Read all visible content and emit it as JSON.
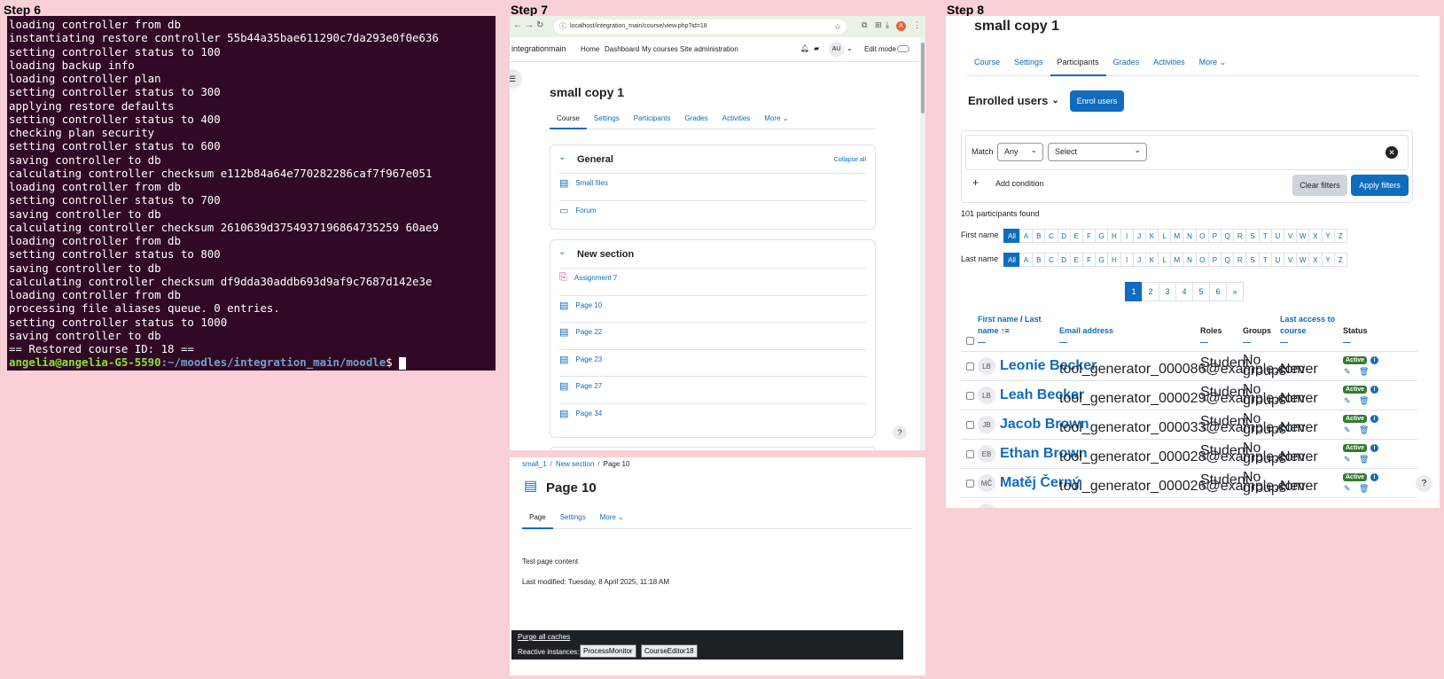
{
  "steps": {
    "s6": "Step 6",
    "s7": "Step 7",
    "s8": "Step 8"
  },
  "terminal": {
    "lines": [
      "loading controller from db",
      "instantiating restore controller 55b44a35bae611290c7da293e0f0e636",
      "setting controller status to 100",
      "loading backup info",
      "loading controller plan",
      "setting controller status to 300",
      "applying restore defaults",
      "setting controller status to 400",
      "checking plan security",
      "setting controller status to 600",
      "saving controller to db",
      "calculating controller checksum e112b84a64e770282286caf7f967e051",
      "loading controller from db",
      "setting controller status to 700",
      "saving controller to db",
      "calculating controller checksum 2610639d3754937196864735259 60ae9",
      "loading controller from db",
      "setting controller status to 800",
      "saving controller to db",
      "calculating controller checksum df9dda30addb693d9af9c7687d142e3e",
      "loading controller from db",
      "processing file aliases queue. 0 entries.",
      "setting controller status to 1000",
      "saving controller to db",
      "== Restored course ID: 18 =="
    ],
    "prompt_user": "angelia@angelia-G5-5590",
    "prompt_path": ":~/moodles/integration_main/moodle",
    "prompt_symbol": "$ "
  },
  "browser": {
    "url": "localhost/integration_main/course/view.php?id=18",
    "site_name": "integrationmain",
    "nav": [
      "Home",
      "Dashboard",
      "My courses",
      "Site administration"
    ],
    "user_initials": "AU",
    "edit_mode": "Edit mode",
    "avatar_letter": "A"
  },
  "course": {
    "title": "small copy 1",
    "tabs": [
      "Course",
      "Settings",
      "Participants",
      "Grades",
      "Activities",
      "More"
    ],
    "sections": [
      {
        "name": "General",
        "collapse": "Collapse all",
        "items": [
          "Small files",
          "Forum"
        ]
      },
      {
        "name": "New section",
        "items": [
          "Assignment 7",
          "Page 10",
          "Page 22",
          "Page 23",
          "Page 27",
          "Page 34"
        ]
      }
    ],
    "help": "?"
  },
  "page10": {
    "breadcrumb": [
      "small_1",
      "New section",
      "Page 10"
    ],
    "title": "Page 10",
    "tabs": [
      "Page",
      "Settings",
      "More"
    ],
    "content": "Test page content",
    "last_modified": "Last modified: Tuesday, 8 April 2025, 11:18 AM",
    "footer_link": "Purge all caches",
    "reactive_label": "Reactive instances:",
    "reactive_buttons": [
      "ProcessMonitor",
      "CourseEditor18"
    ]
  },
  "participants": {
    "course_title": "small copy 1",
    "tabs": [
      "Course",
      "Settings",
      "Participants",
      "Grades",
      "Activities",
      "More"
    ],
    "heading": "Enrolled users",
    "enrol_button": "Enrol users",
    "match_label": "Match",
    "match_value": "Any",
    "select_value": "Select",
    "add_condition": "Add condition",
    "clear_filters": "Clear filters",
    "apply_filters": "Apply filters",
    "found": "101 participants found",
    "first_name_label": "First name",
    "last_name_label": "Last name",
    "letters": [
      "All",
      "A",
      "B",
      "C",
      "D",
      "E",
      "F",
      "G",
      "H",
      "I",
      "J",
      "K",
      "L",
      "M",
      "N",
      "O",
      "P",
      "Q",
      "R",
      "S",
      "T",
      "U",
      "V",
      "W",
      "X",
      "Y",
      "Z"
    ],
    "pages": [
      "1",
      "2",
      "3",
      "4",
      "5",
      "6",
      "»"
    ],
    "columns": {
      "first_name": "First name",
      "slash": " / ",
      "last_name": "Last name",
      "email": "Email address",
      "roles": "Roles",
      "groups": "Groups",
      "last_access": "Last access to course",
      "status": "Status"
    },
    "rows": [
      {
        "initials": "LB",
        "name": "Leonie Becker",
        "email": "tool_generator_000086@example.com",
        "role": "Student",
        "groups": "No groups",
        "access": "Never",
        "status": "Active"
      },
      {
        "initials": "LB",
        "name": "Leah Becker",
        "email": "tool_generator_000029@example.com",
        "role": "Student",
        "groups": "No groups",
        "access": "Never",
        "status": "Active"
      },
      {
        "initials": "JB",
        "name": "Jacob Brown",
        "email": "tool_generator_000033@example.com",
        "role": "Student",
        "groups": "No groups",
        "access": "Never",
        "status": "Active"
      },
      {
        "initials": "EB",
        "name": "Ethan Brown",
        "email": "tool_generator_000028@example.com",
        "role": "Student",
        "groups": "No groups",
        "access": "Never",
        "status": "Active"
      },
      {
        "initials": "MČ",
        "name": "Matěj Černý",
        "email": "tool_generator_000026@example.com",
        "role": "Student",
        "groups": "No groups",
        "access": "Never",
        "status": "Active"
      }
    ],
    "help": "?"
  }
}
